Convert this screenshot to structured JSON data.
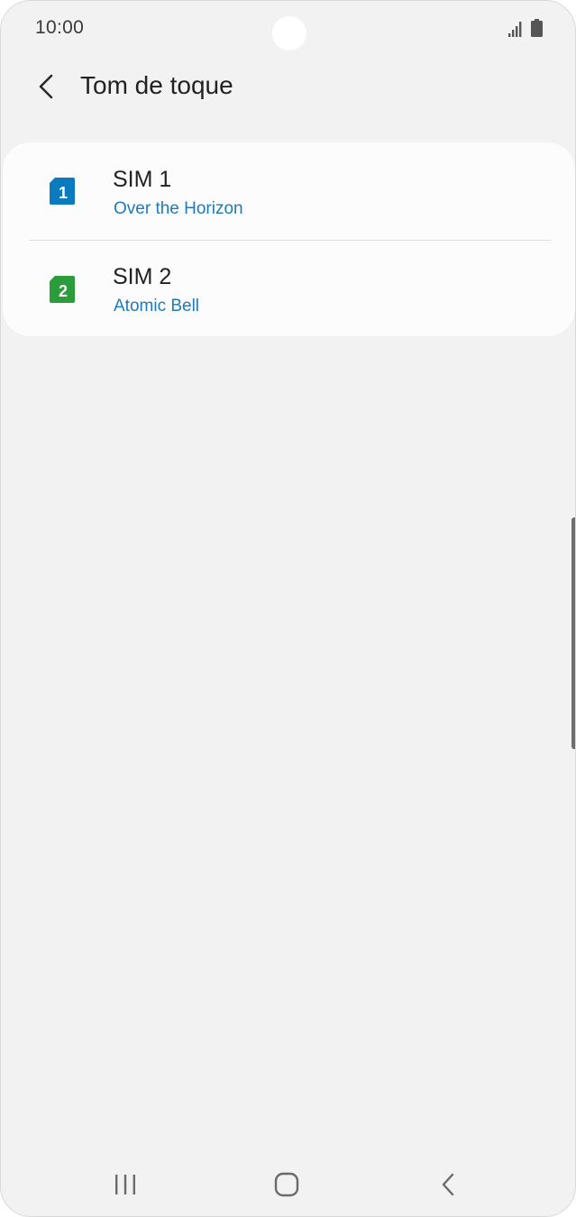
{
  "status_bar": {
    "time": "10:00",
    "icons": [
      "signal-icon",
      "battery-icon"
    ]
  },
  "app_bar": {
    "title": "Tom de toque",
    "back_icon": "back-arrow-icon"
  },
  "sim_list": [
    {
      "title": "SIM 1",
      "subtitle": "Over the Horizon",
      "badge": "1",
      "icon": "sim-card-icon",
      "color": "#0b7bc0"
    },
    {
      "title": "SIM 2",
      "subtitle": "Atomic Bell",
      "badge": "2",
      "icon": "sim-card-icon",
      "color": "#2a9d3a"
    }
  ],
  "colors": {
    "background": "#f2f2f2",
    "card": "#fcfcfc",
    "subtitle": "#1f7ab8",
    "text": "#222222"
  },
  "nav_bar": {
    "icons": [
      "recent-apps-icon",
      "home-icon",
      "back-icon"
    ]
  }
}
